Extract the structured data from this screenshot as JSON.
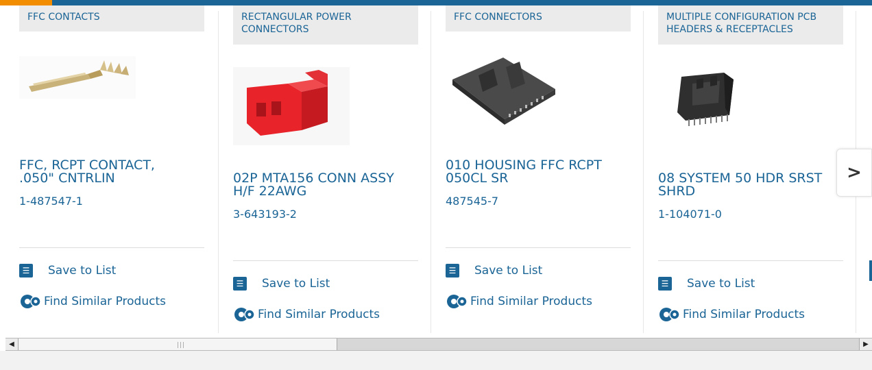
{
  "colors": {
    "brand_blue": "#1a6496",
    "accent_orange": "#f28c00",
    "category_bg": "#ebebeb"
  },
  "cards": [
    {
      "category": "FFC CONTACTS",
      "title": "FFC, RCPT CONTACT, .050\" CNTRLIN",
      "part_number": "1-487547-1",
      "save_label": "Save to List",
      "similar_label": "Find Similar Products",
      "image_icon": "ffc-contact-image"
    },
    {
      "category": "RECTANGULAR POWER CONNECTORS",
      "title": "02P MTA156 CONN ASSY H/F 22AWG",
      "part_number": "3-643193-2",
      "save_label": "Save to List",
      "similar_label": "Find Similar Products",
      "image_icon": "red-connector-image"
    },
    {
      "category": "FFC CONNECTORS",
      "title": "010 HOUSING FFC RCPT 050CL SR",
      "part_number": "487545-7",
      "save_label": "Save to List",
      "similar_label": "Find Similar Products",
      "image_icon": "ffc-housing-image"
    },
    {
      "category": "MULTIPLE CONFIGURATION PCB HEADERS & RECEPTACLES",
      "title": "08 SYSTEM 50 HDR SRST SHRD",
      "part_number": "1-104071-0",
      "save_label": "Save to List",
      "similar_label": "Find Similar Products",
      "image_icon": "pcb-header-image"
    }
  ],
  "carousel": {
    "next_icon": "chevron-right-icon",
    "next_label": ">"
  }
}
